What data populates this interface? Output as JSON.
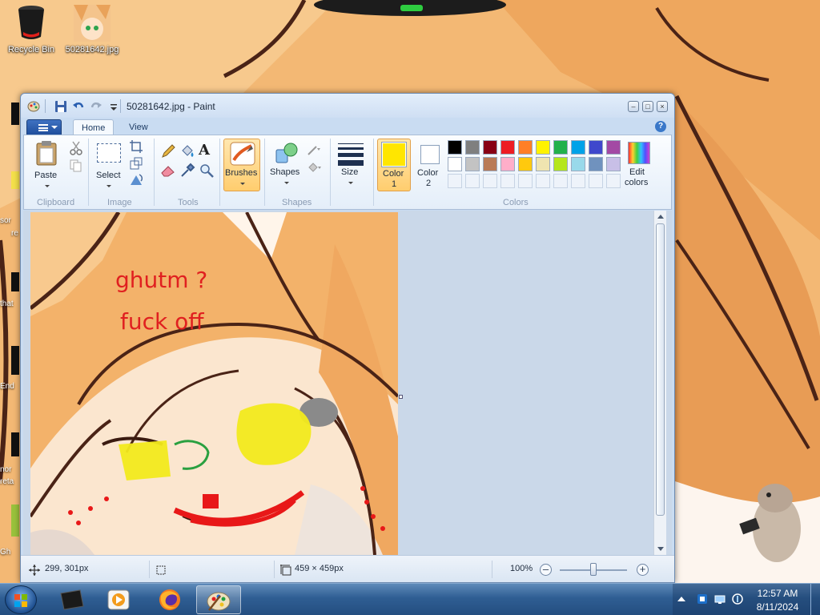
{
  "desktop": {
    "icons": [
      {
        "label": "Recycle Bin"
      },
      {
        "label": "50281642.jpg"
      }
    ],
    "edge_labels": [
      "sor",
      "re",
      "that",
      "End",
      "nor",
      "reta",
      "Gh"
    ]
  },
  "window": {
    "title": "50281642.jpg - Paint",
    "tabs": [
      {
        "label": "Home"
      },
      {
        "label": "View"
      }
    ],
    "ribbon": {
      "clipboard": {
        "group": "Clipboard",
        "paste": "Paste"
      },
      "image": {
        "group": "Image",
        "select": "Select"
      },
      "tools": {
        "group": "Tools"
      },
      "brushes": {
        "label": "Brushes"
      },
      "shapes": {
        "group": "Shapes",
        "label": "Shapes"
      },
      "size": {
        "label": "Size"
      },
      "color1": {
        "label_a": "Color",
        "label_b": "1",
        "value": "#ffe600"
      },
      "color2": {
        "label_a": "Color",
        "label_b": "2",
        "value": "#ffffff"
      },
      "colors": {
        "group": "Colors",
        "edit_a": "Edit",
        "edit_b": "colors",
        "row1": [
          "#000000",
          "#7f7f7f",
          "#880015",
          "#ed1c24",
          "#ff7f27",
          "#fff200",
          "#22b14c",
          "#00a2e8",
          "#3f48cc",
          "#a349a4"
        ],
        "row2": [
          "#ffffff",
          "#c3c3c3",
          "#b97a57",
          "#ffaec9",
          "#ffc90e",
          "#efe4b0",
          "#b5e61d",
          "#99d9ea",
          "#7092be",
          "#c8bfe7"
        ]
      }
    },
    "canvas": {
      "texts": [
        "ghutm ?",
        "fuck off"
      ],
      "text_color": "#e02020"
    },
    "status": {
      "cursor_pos": "299, 301px",
      "image_size": "459 × 459px",
      "zoom": "100%"
    }
  },
  "taskbar": {
    "time": "12:57 AM",
    "date": "8/11/2024"
  }
}
